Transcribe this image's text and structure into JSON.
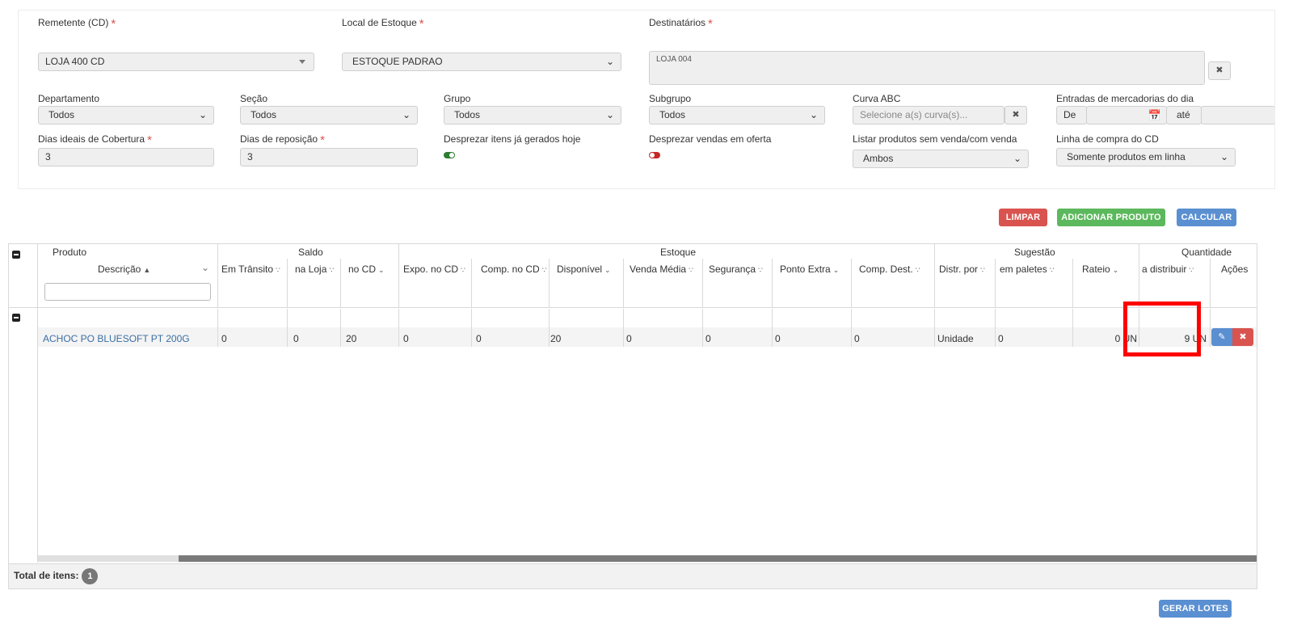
{
  "form": {
    "remetente_label": "Remetente (CD)",
    "remetente_value": "LOJA 400 CD",
    "local_label": "Local de Estoque",
    "local_value": "ESTOQUE PADRAO",
    "destinatarios_label": "Destinatários",
    "destinatarios_value": "LOJA 004",
    "departamento_label": "Departamento",
    "departamento_value": "Todos",
    "secao_label": "Seção",
    "secao_value": "Todos",
    "grupo_label": "Grupo",
    "grupo_value": "Todos",
    "subgrupo_label": "Subgrupo",
    "subgrupo_value": "Todos",
    "curva_label": "Curva ABC",
    "curva_placeholder": "Selecione a(s) curva(s)...",
    "entradas_label": "Entradas de mercadorias do dia",
    "entradas_de": "De",
    "entradas_ate": "até",
    "dias_cobertura_label": "Dias ideais de Cobertura",
    "dias_cobertura_value": "3",
    "dias_reposicao_label": "Dias de reposição",
    "dias_reposicao_value": "3",
    "desprezar_itens_label": "Desprezar itens já gerados hoje",
    "desprezar_itens_on": true,
    "desprezar_vendas_label": "Desprezar vendas em oferta",
    "desprezar_vendas_on": false,
    "listar_label": "Listar produtos sem venda/com venda",
    "listar_value": "Ambos",
    "linha_label": "Linha de compra do CD",
    "linha_value": "Somente produtos em linha"
  },
  "actions": {
    "limpar": "LIMPAR",
    "adicionar": "ADICIONAR PRODUTO",
    "calcular": "CALCULAR",
    "gerar_lotes": "GERAR LOTES"
  },
  "grid": {
    "groups": {
      "produto": "Produto",
      "saldo": "Saldo",
      "estoque": "Estoque",
      "sugestao": "Sugestão",
      "quantidade": "Quantidade"
    },
    "columns": {
      "descricao": "Descrição",
      "em_transito": "Em Trânsito",
      "na_loja": "na Loja",
      "no_cd": "no CD",
      "expo_cd": "Expo. no CD",
      "comp_cd": "Comp. no CD",
      "disponivel": "Disponível",
      "venda_media": "Venda Média",
      "seguranca": "Segurança",
      "ponto_extra": "Ponto Extra",
      "comp_dest": "Comp. Dest.",
      "distr_por": "Distr. por",
      "em_paletes": "em paletes",
      "rateio": "Rateio",
      "a_distribuir": "a distribuir",
      "acoes": "Ações"
    },
    "row": {
      "descricao": "ACHOC PO BLUESOFT PT 200G",
      "em_transito": "0",
      "na_loja": "0",
      "no_cd": "20",
      "expo_cd": "0",
      "comp_cd": "0",
      "disponivel": "20",
      "venda_media": "0",
      "seguranca": "0",
      "ponto_extra": "0",
      "comp_dest": "0",
      "distr_por": "Unidade",
      "em_paletes": "0",
      "rateio": "0 UN",
      "a_distribuir": "9 UN"
    },
    "total_label": "Total de itens:",
    "total_count": "1"
  },
  "colors": {
    "red": "#d9534f",
    "green": "#5cb85c",
    "blue": "#5a8fd1",
    "link": "#3a6ea5",
    "highlight": "#ff0000"
  }
}
